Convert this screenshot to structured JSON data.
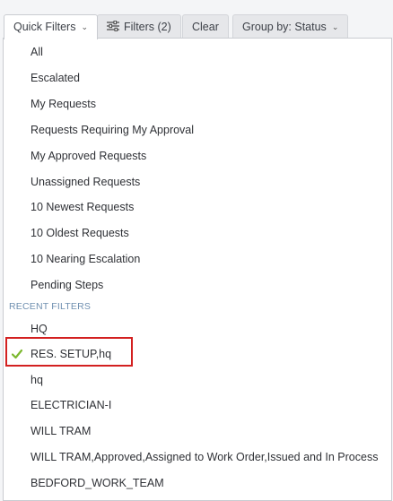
{
  "toolbar": {
    "quick_filters_label": "Quick Filters",
    "filters_label": "Filters (2)",
    "clear_label": "Clear",
    "group_by_label": "Group by: Status"
  },
  "menu": {
    "items": [
      "All",
      "Escalated",
      "My Requests",
      "Requests Requiring My Approval",
      "My Approved Requests",
      "Unassigned Requests",
      "10 Newest Requests",
      "10 Oldest Requests",
      "10 Nearing Escalation",
      "Pending Steps"
    ],
    "recent_header": "RECENT FILTERS",
    "recent": [
      "HQ",
      "RES. SETUP,hq",
      "hq",
      "ELECTRICIAN-I",
      "WILL TRAM",
      "WILL TRAM,Approved,Assigned to Work Order,Issued and In Process",
      "BEDFORD_WORK_TEAM"
    ],
    "selected_recent": "RES. SETUP,hq"
  },
  "colors": {
    "check": "#7cb82f",
    "highlight": "#d32020",
    "section_header": "#6f8fb0"
  },
  "icons": {
    "filters": "sliders-icon",
    "selected": "check-icon",
    "dropdown": "chevron-down-icon"
  }
}
